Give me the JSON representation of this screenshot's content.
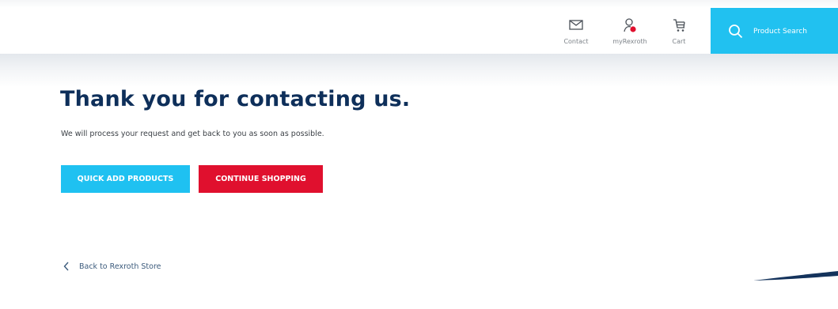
{
  "header": {
    "nav": {
      "contact": {
        "label": "Contact",
        "icon": "envelope-icon"
      },
      "my_account": {
        "label": "myRexroth",
        "icon": "user-icon"
      },
      "cart": {
        "label": "Cart",
        "icon": "cart-icon"
      }
    },
    "search": {
      "label": "Product Search",
      "icon": "search-icon"
    }
  },
  "main": {
    "title": "Thank you for contacting us.",
    "message": "We will process your request and get back to you as soon as possible.",
    "buttons": {
      "quick_add": "QUICK ADD PRODUCTS",
      "continue_shopping": "CONTINUE SHOPPING"
    },
    "back_link": "Back to Rexroth Store"
  },
  "colors": {
    "accent_blue": "#21c1f0",
    "accent_red": "#e0102e",
    "title_navy": "#0e2f5a"
  }
}
